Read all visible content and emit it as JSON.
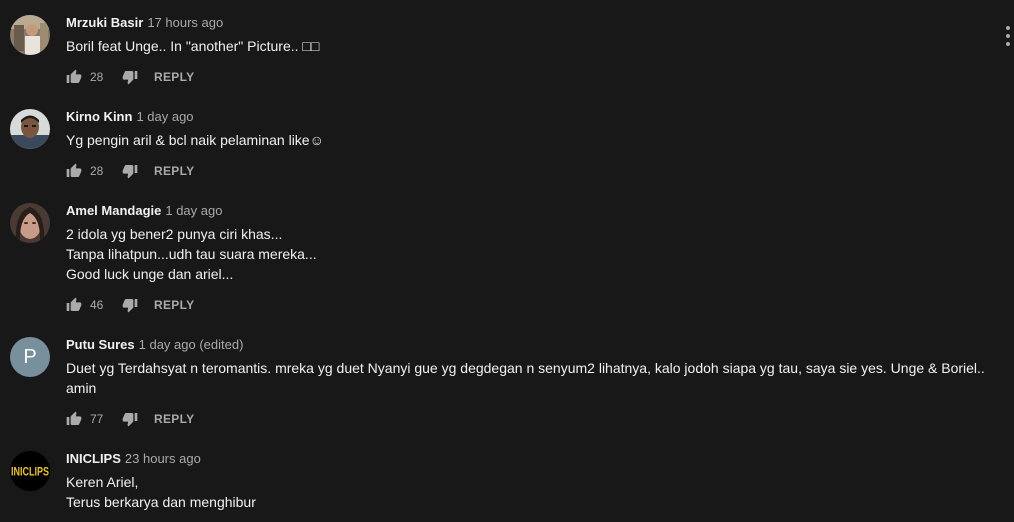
{
  "colors": {
    "background": "#181818",
    "primary_text": "#f1f1f1",
    "secondary_text": "#aaaaaa",
    "letter_avatar_bg": "#78909c",
    "logo_text": "#f0c419"
  },
  "icons": {
    "like": "thumb-up-icon",
    "dislike": "thumb-down-icon",
    "menu": "more-vert-icon"
  },
  "comments": [
    {
      "author": "Mrzuki Basir",
      "time": "17 hours ago",
      "lines": [
        "Boril feat Unge.. In \"another\" Picture.. □□"
      ],
      "likes": "28",
      "reply_label": "REPLY"
    },
    {
      "author": "Kirno Kinn",
      "time": "1 day ago",
      "lines": [
        "Yg pengin aril & bcl naik pelaminan  like☺"
      ],
      "likes": "28",
      "reply_label": "REPLY"
    },
    {
      "author": "Amel Mandagie",
      "time": "1 day ago",
      "lines": [
        "2 idola yg bener2 punya ciri khas...",
        "Tanpa lihatpun...udh tau suara mereka...",
        "Good luck unge dan ariel..."
      ],
      "likes": "46",
      "reply_label": "REPLY"
    },
    {
      "author": "Putu Sures",
      "time": "1 day ago (edited)",
      "avatar_letter": "P",
      "lines": [
        "Duet yg Terdahsyat n teromantis. mreka yg duet Nyanyi gue yg degdegan n senyum2 lihatnya, kalo jodoh siapa yg tau, saya sie yes. Unge & Boriel..",
        "amin"
      ],
      "likes": "77",
      "reply_label": "REPLY"
    },
    {
      "author": "INICLIPS",
      "time": "23 hours ago",
      "avatar_logo_text": "INICLIPS",
      "lines": [
        "Keren Ariel,",
        "Terus berkarya dan menghibur"
      ]
    }
  ]
}
